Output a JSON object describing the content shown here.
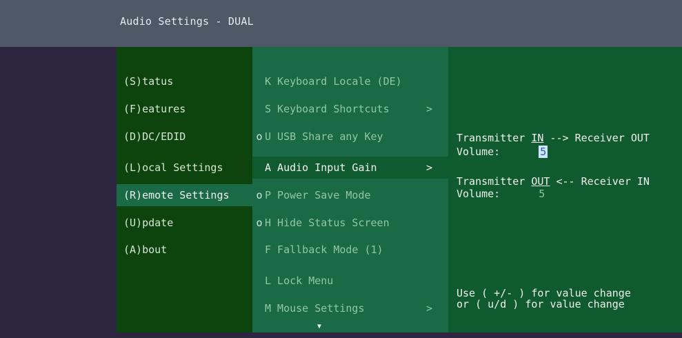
{
  "window": {
    "title": "Audio Settings - DUAL"
  },
  "main_menu": {
    "items": [
      {
        "label": "(S)tatus"
      },
      {
        "label": "(F)eatures"
      },
      {
        "label": "(D)DC/EDID"
      },
      {
        "label": "(L)ocal  Settings"
      },
      {
        "label": "(R)emote Settings"
      },
      {
        "label": "(U)pdate"
      },
      {
        "label": "(A)bout"
      }
    ]
  },
  "sub_menu": {
    "items": [
      {
        "bullet": "",
        "label": "K Keyboard Locale (DE)",
        "arrow": ""
      },
      {
        "bullet": "",
        "label": "S Keyboard Shortcuts",
        "arrow": ">"
      },
      {
        "bullet": "o",
        "label": "U USB Share any Key",
        "arrow": ""
      },
      {
        "bullet": "",
        "label": "A Audio Input Gain",
        "arrow": ">"
      },
      {
        "bullet": "o",
        "label": "P Power Save Mode",
        "arrow": ""
      },
      {
        "bullet": "o",
        "label": "H Hide Status Screen",
        "arrow": ""
      },
      {
        "bullet": "",
        "label": "F Fallback Mode (1)",
        "arrow": ""
      },
      {
        "bullet": "",
        "label": "L Lock Menu",
        "arrow": ""
      },
      {
        "bullet": "",
        "label": "M Mouse Settings",
        "arrow": ">"
      }
    ],
    "scroll_down": "▼"
  },
  "detail": {
    "tx_label_a": "Transmitter ",
    "tx_label_in": "IN",
    "tx_label_b": " --> Receiver OUT",
    "tx_volume_label": "Volume:",
    "tx_volume_value": "5",
    "rx_label_a": "Transmitter ",
    "rx_label_out": "OUT",
    "rx_label_b": " <-- Receiver IN",
    "rx_volume_label": "Volume:",
    "rx_volume_value": "5",
    "hint_line1": "Use ( +/- ) for value change",
    "hint_line2": "or  ( u/d ) for value change"
  }
}
